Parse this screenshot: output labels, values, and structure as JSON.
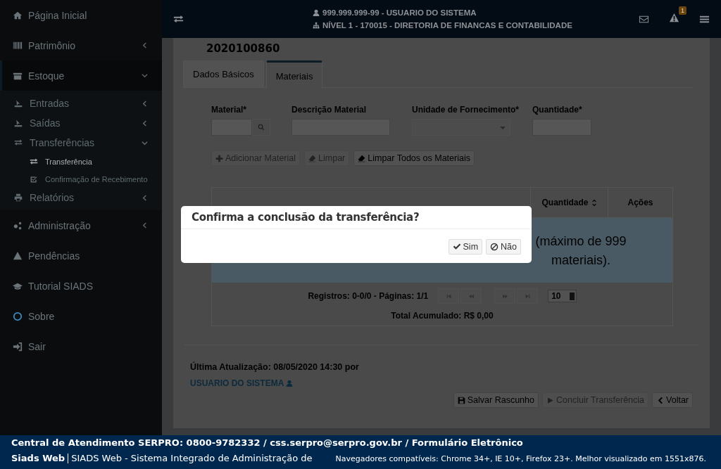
{
  "sidebar": {
    "items": [
      {
        "label": "Página Inicial"
      },
      {
        "label": "Patrimônio",
        "expanded": false
      },
      {
        "label": "Estoque",
        "expanded": true,
        "children": [
          {
            "label": "Entradas",
            "expanded": false
          },
          {
            "label": "Saídas",
            "expanded": false
          },
          {
            "label": "Transferências",
            "expanded": true,
            "children": [
              {
                "label": "Transferência",
                "selected": true
              },
              {
                "label": "Confirmação de Recebimento",
                "selected": false
              }
            ]
          },
          {
            "label": "Relatórios",
            "expanded": false
          }
        ]
      },
      {
        "label": "Administração",
        "expanded": false
      },
      {
        "label": "Pendências"
      },
      {
        "label": "Tutorial SIADS"
      },
      {
        "label": "Sobre"
      },
      {
        "label": "Sair"
      }
    ]
  },
  "header": {
    "user": "999.999.999-99 - USUARIO DO SISTEMA",
    "unit": "NÍVEL 1 - 170015 - DIRETORIA DE FINANCAS E CONTABILIDADE",
    "alerts_badge": "1"
  },
  "record": {
    "number": "2020100860"
  },
  "tabs": [
    {
      "label": "Dados Básicos",
      "selected": false
    },
    {
      "label": "Materiais",
      "selected": true
    }
  ],
  "form": {
    "fields": [
      {
        "label": "Material*",
        "kind": "search"
      },
      {
        "label": "Descrição Material",
        "kind": "text"
      },
      {
        "label": "Unidade de Fornecimento*",
        "kind": "select"
      },
      {
        "label": "Quantidade*",
        "kind": "text"
      }
    ],
    "buttons": [
      {
        "label": "Adicionar Material",
        "disabled": true
      },
      {
        "label": "Limpar",
        "disabled": true
      },
      {
        "label": "Limpar Todos os Materiais",
        "disabled": false
      }
    ]
  },
  "table": {
    "columns": [
      "Quantidade",
      "Ações"
    ],
    "empty_message": "(máximo de 999 materiais).",
    "records": "Registros: 0-0/0 - Páginas: 1/1",
    "page_size": "10",
    "total": "Total Acumulado: R$ 0,00"
  },
  "last_update": {
    "text": "Última Atualização: 08/05/2020 14:30 por",
    "user": "USUARIO DO SISTEMA"
  },
  "actions": [
    {
      "label": "Salvar Rascunho",
      "disabled": false
    },
    {
      "label": "Concluir Transferência",
      "disabled": true
    },
    {
      "label": "Voltar",
      "disabled": false
    }
  ],
  "dialog": {
    "title": "Confirma a conclusão da transferência?",
    "buttons": [
      "Sim",
      "Não"
    ]
  },
  "footer": {
    "contact": "Central de Atendimento SERPRO: 0800-9782332 / css.serpro@serpro.gov.br / Formulário Eletrônico",
    "brand": "Siads Web",
    "system": "SIADS Web - Sistema Integrado de Administração de",
    "browsers": "Navegadores compatíveis: Chrome 34+, IE 10+, Firefox 23+. Melhor visualizado em 1551x876."
  }
}
